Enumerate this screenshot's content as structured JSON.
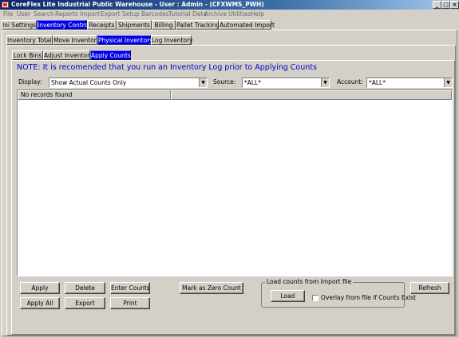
{
  "window": {
    "title": "CoreFlex Lite Industrial Public Warehouse - User : Admin - (CFXWMS_PWH)",
    "minimize_glyph": "_",
    "maximize_glyph": "□",
    "close_glyph": "×"
  },
  "menu": [
    "File",
    "User",
    "Search",
    "Reports",
    "Import",
    "Export",
    "Setup",
    "Barcodes",
    "Tutorial Data",
    "Archive",
    "Utilities",
    "Help"
  ],
  "main_tabs": [
    "Ini Settings",
    "Inventory Control",
    "Receipts",
    "Shipments",
    "Billing",
    "Pallet Tracking",
    "Automated Import"
  ],
  "sub_tabs": [
    "Inventory Totals",
    "Move Inventory",
    "Physical Inventory",
    "Log Inventory"
  ],
  "sub_sub_tabs": [
    "Lock Bins",
    "Adjust Inventory",
    "Apply Counts"
  ],
  "note": "NOTE:  It is recomended that you run an Inventory Log prior to Applying Counts",
  "filters": {
    "display_label": "Display:",
    "display_value": "Show Actual Counts Only",
    "source_label": "Source:",
    "source_value": "*ALL*",
    "account_label": "Account:",
    "account_value": "*ALL*"
  },
  "grid": {
    "empty_message": "No records found"
  },
  "buttons": {
    "apply": "Apply",
    "delete": "Delete",
    "enter_counts": "Enter Counts",
    "apply_all": "Apply All",
    "export": "Export",
    "print": "Print",
    "mark_zero": "Mark as Zero Count",
    "refresh": "Refresh",
    "load": "Load"
  },
  "import_group": {
    "title": "Load counts from Import file",
    "overlay_label": "Overlay from file if Counts Exist",
    "overlay_checked": false
  },
  "colors": {
    "selected_tab": "#0000e6",
    "note_text": "#0000cc",
    "title_bar": "#0a246a"
  }
}
